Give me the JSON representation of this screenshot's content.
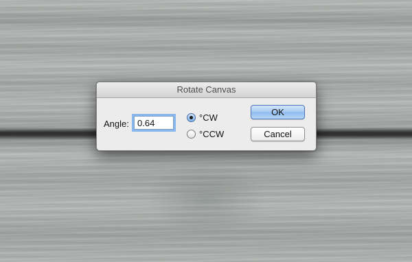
{
  "dialog": {
    "title": "Rotate Canvas",
    "angle_label": "Angle:",
    "angle_value": "0.64",
    "options": [
      {
        "label": "°CW",
        "selected": true
      },
      {
        "label": "°CCW",
        "selected": false
      }
    ],
    "ok_label": "OK",
    "cancel_label": "Cancel"
  },
  "colors": {
    "accent": "#8ab6ee",
    "dialog_bg": "#ececec",
    "wood": "#a9aeab"
  },
  "icons": {
    "radio_checked": "radio-checked-icon",
    "radio_unchecked": "radio-unchecked-icon"
  }
}
